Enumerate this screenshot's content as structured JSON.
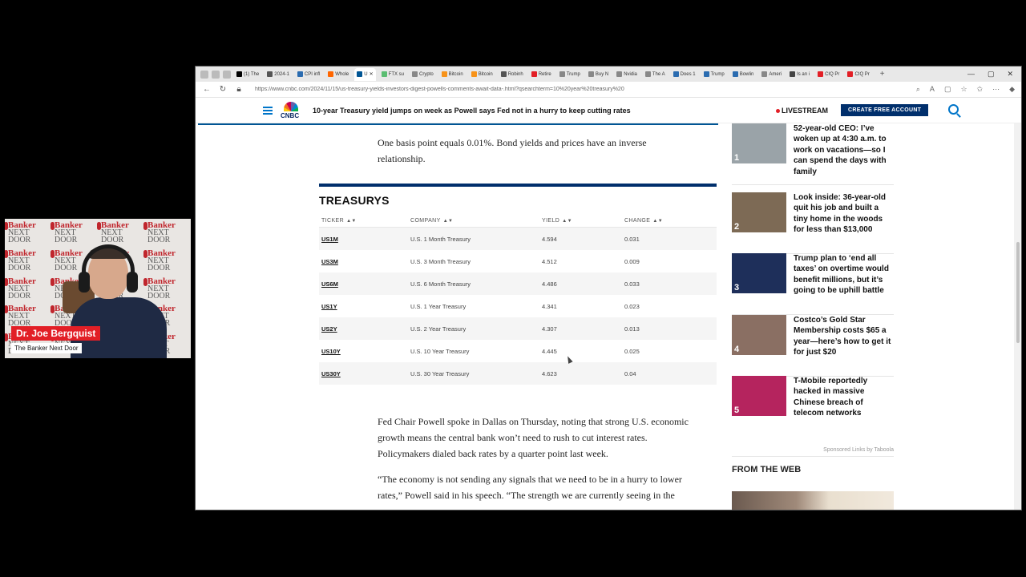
{
  "webcam": {
    "name": "Dr. Joe Bergquist",
    "subtitle": "The Banker Next Door",
    "bg_line1": "Banker",
    "bg_line2": "NEXT DOOR"
  },
  "browser": {
    "tabs": [
      {
        "label": "(1) The",
        "color": "#000000"
      },
      {
        "label": "2024-1",
        "color": "#555555"
      },
      {
        "label": "CPI infl",
        "color": "#2b6cb0"
      },
      {
        "label": "Whole",
        "color": "#ff6600"
      },
      {
        "label": "U",
        "color": "#005594",
        "active": true
      },
      {
        "label": "FTX su",
        "color": "#5bbd72"
      },
      {
        "label": "Crypto",
        "color": "#888888"
      },
      {
        "label": "Bitcoin",
        "color": "#f7931a"
      },
      {
        "label": "Bitcoin",
        "color": "#f7931a"
      },
      {
        "label": "Robinh",
        "color": "#555555"
      },
      {
        "label": "Retire",
        "color": "#e21f26"
      },
      {
        "label": "Trump",
        "color": "#888888"
      },
      {
        "label": "Buy N",
        "color": "#888888"
      },
      {
        "label": "Nvidia",
        "color": "#888888"
      },
      {
        "label": "The A",
        "color": "#888888"
      },
      {
        "label": "Does 1",
        "color": "#2b6cb0"
      },
      {
        "label": "Trump",
        "color": "#2b6cb0"
      },
      {
        "label": "Bowlin",
        "color": "#2b6cb0"
      },
      {
        "label": "Ameri",
        "color": "#888888"
      },
      {
        "label": "Is an i",
        "color": "#444444"
      },
      {
        "label": "CIQ Pr",
        "color": "#e21f26"
      },
      {
        "label": "CIQ Pr",
        "color": "#e21f26"
      }
    ],
    "url": "https://www.cnbc.com/2024/11/15/us-treasury-yields-investors-digest-powells-comments-await-data-.html?qsearchterm=10%20year%20treasury%20"
  },
  "header": {
    "logo": "CNBC",
    "headline": "10-year Treasury yield jumps on week as Powell says Fed not in a hurry to keep cutting rates",
    "livestream": "LIVESTREAM",
    "cta": "CREATE FREE ACCOUNT"
  },
  "article": {
    "intro": "One basis point equals 0.01%. Bond yields and prices have an inverse relationship.",
    "para1": "Fed Chair Powell spoke in Dallas on Thursday, noting that strong U.S. economic growth means the central bank won’t need to rush to cut interest rates. Policymakers dialed back rates by a quarter point last week.",
    "para2": "“The economy is not sending any signals that we need to be in a hurry to lower rates,” Powell said in his speech. “The strength we are currently seeing in the"
  },
  "treasurys": {
    "title": "TREASURYS",
    "columns": [
      "TICKER",
      "COMPANY",
      "YIELD",
      "CHANGE"
    ],
    "rows": [
      {
        "ticker": "US1M",
        "company": "U.S. 1 Month Treasury",
        "yield": "4.594",
        "change": "0.031"
      },
      {
        "ticker": "US3M",
        "company": "U.S. 3 Month Treasury",
        "yield": "4.512",
        "change": "0.009"
      },
      {
        "ticker": "US6M",
        "company": "U.S. 6 Month Treasury",
        "yield": "4.486",
        "change": "0.033"
      },
      {
        "ticker": "US1Y",
        "company": "U.S. 1 Year Treasury",
        "yield": "4.341",
        "change": "0.023"
      },
      {
        "ticker": "US2Y",
        "company": "U.S. 2 Year Treasury",
        "yield": "4.307",
        "change": "0.013"
      },
      {
        "ticker": "US10Y",
        "company": "U.S. 10 Year Treasury",
        "yield": "4.445",
        "change": "0.025"
      },
      {
        "ticker": "US30Y",
        "company": "U.S. 30 Year Treasury",
        "yield": "4.623",
        "change": "0.04"
      }
    ]
  },
  "sidebar": {
    "items": [
      {
        "num": "1",
        "text": "52-year-old CEO: I’ve woken up at 4:30 a.m. to work on vacations—so I can spend the days with family",
        "color": "#9aa3a8"
      },
      {
        "num": "2",
        "text": "Look inside: 36-year-old quit his job and built a tiny home in the woods for less than $13,000",
        "color": "#7d6a55"
      },
      {
        "num": "3",
        "text": "Trump plan to ‘end all taxes’ on overtime would benefit millions, but it’s going to be uphill battle",
        "color": "#1e2f5a"
      },
      {
        "num": "4",
        "text": "Costco’s Gold Star Membership costs $65 a year—here’s how to get it for just $20",
        "color": "#8a6f63"
      },
      {
        "num": "5",
        "text": "T-Mobile reportedly hacked in massive Chinese breach of telecom networks",
        "color": "#b5245e"
      }
    ],
    "sponsored": "Sponsored Links by Taboola",
    "from_the_web": "FROM THE WEB"
  }
}
